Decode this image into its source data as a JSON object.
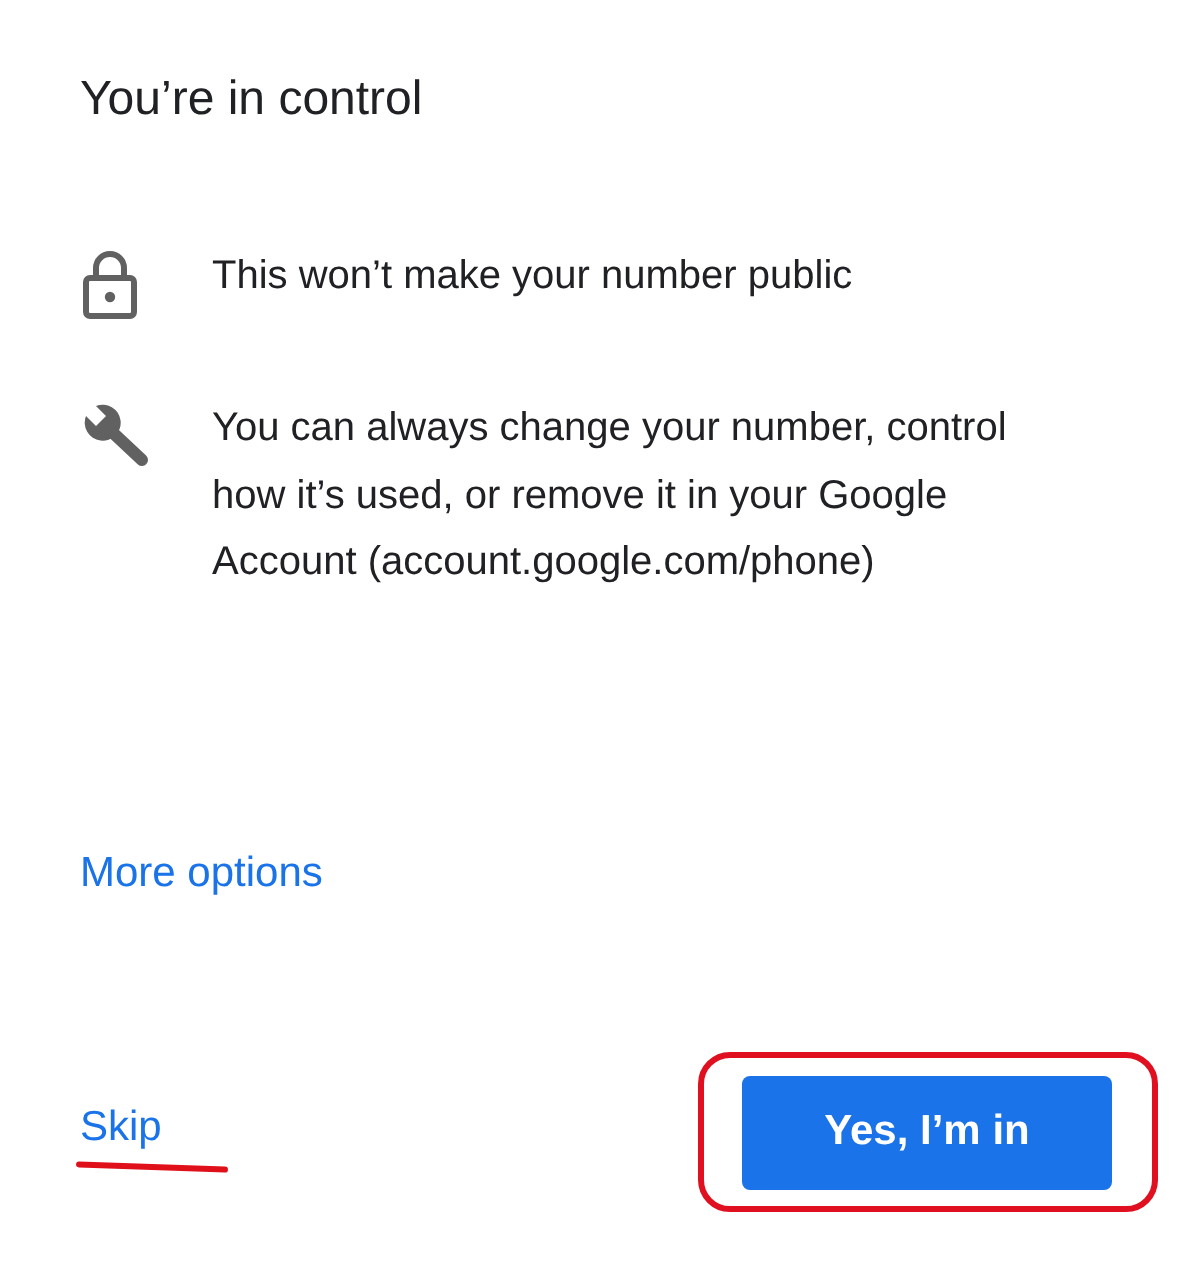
{
  "title": "You’re in control",
  "items": [
    {
      "kind": "lock",
      "text": "This won’t make your number public"
    },
    {
      "kind": "wrench",
      "text": "You can always change your number, control how it’s used, or remove it in your Google Account (account.google.com/phone)"
    }
  ],
  "more_options": "More options",
  "skip": "Skip",
  "confirm": "Yes, I’m in"
}
